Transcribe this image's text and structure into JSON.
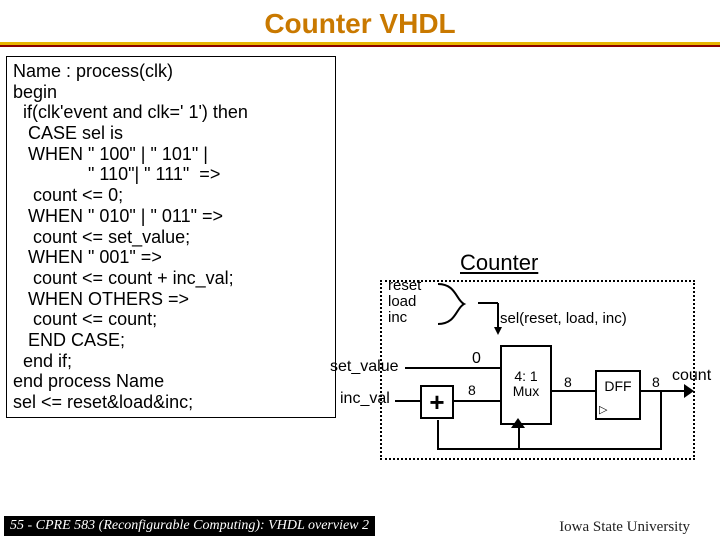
{
  "title": "Counter VHDL",
  "code": "Name : process(clk)\nbegin\n  if(clk'event and clk=' 1') then\n   CASE sel is\n   WHEN \" 100\" | \" 101\" |\n               \" 110\"| \" 111\"  =>\n    count <= 0;\n   WHEN \" 010\" | \" 011\" =>\n    count <= set_value;\n   WHEN \" 001\" =>\n    count <= count + inc_val;\n   WHEN OTHERS =>\n    count <= count;\n   END CASE;\n  end if;\nend process Name\nsel <= reset&load&inc;",
  "diagram": {
    "title": "Counter",
    "signals": {
      "reset": "reset",
      "load": "load",
      "inc": "inc",
      "sel_expr": "sel(reset, load, inc)",
      "set_value": "set_value",
      "inc_val": "inc_val",
      "zero": "0"
    },
    "blocks": {
      "adder": "+",
      "mux": "4: 1\nMux",
      "dff": "DFF"
    },
    "bus_widths": {
      "adder_out": "8",
      "mux_out": "8",
      "dff_out": "8"
    },
    "output": "count"
  },
  "footer": {
    "left": "55 - CPRE 583 (Reconfigurable Computing):  VHDL overview 2",
    "right": "Iowa State University"
  }
}
